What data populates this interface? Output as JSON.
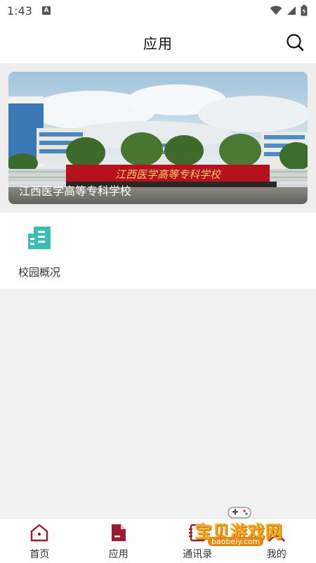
{
  "status_bar": {
    "time": "1:43",
    "a_badge": "A"
  },
  "header": {
    "title": "应用"
  },
  "banner": {
    "caption": "江西医学高等专科学校",
    "gate_sign": "江西医学高等专科学校"
  },
  "apps": [
    {
      "label": "校园概况",
      "icon": "building-icon"
    }
  ],
  "tabbar": {
    "items": [
      {
        "label": "首页",
        "icon": "home-icon",
        "active": false
      },
      {
        "label": "应用",
        "icon": "document-icon",
        "active": true
      },
      {
        "label": "通讯录",
        "icon": "contacts-icon",
        "active": false
      },
      {
        "label": "我的",
        "icon": "user-icon",
        "active": false
      }
    ]
  },
  "watermark": {
    "text": "宝贝游戏网",
    "url": "baobeiy.com"
  },
  "colors": {
    "brand": "#9b1c31",
    "app_icon": "#3dbcb4",
    "watermark": "#f3a21c"
  }
}
